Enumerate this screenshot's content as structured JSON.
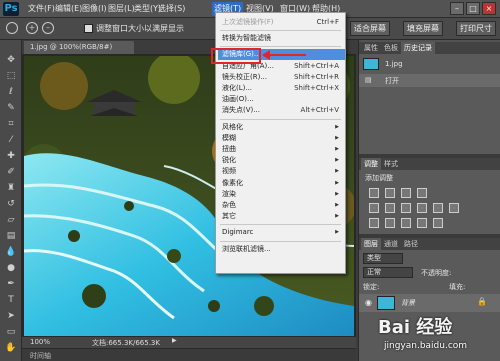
{
  "app": {
    "logo": "Ps"
  },
  "menubar": {
    "items": [
      "文件(F)",
      "编辑(E)",
      "图像(I)",
      "图层(L)",
      "类型(Y)",
      "选择(S)",
      "滤镜(T)",
      "视图(V)",
      "窗口(W)",
      "帮助(H)"
    ],
    "active_index": 6
  },
  "options": {
    "checkbox_label": "调整窗口大小以满屏显示",
    "buttons": [
      "适合屏幕",
      "填充屏幕",
      "打印尺寸"
    ]
  },
  "document": {
    "tab_title": "1.jpg @ 100%(RGB/8#)",
    "zoom": "100%",
    "doc_info": "文档:665.3K/665.3K",
    "timeline_label": "时间轴"
  },
  "filter_menu": {
    "items": [
      {
        "label": "上次滤镜操作(F)",
        "shortcut": "Ctrl+F",
        "disabled": true
      },
      {
        "sep": true
      },
      {
        "label": "转换为智能滤镜"
      },
      {
        "sep": true
      },
      {
        "label": "滤镜库(G)...",
        "highlighted": true
      },
      {
        "label": "自适应广角(A)...",
        "shortcut": "Shift+Ctrl+A"
      },
      {
        "label": "镜头校正(R)...",
        "shortcut": "Shift+Ctrl+R"
      },
      {
        "label": "液化(L)...",
        "shortcut": "Shift+Ctrl+X"
      },
      {
        "label": "油画(O)..."
      },
      {
        "label": "消失点(V)...",
        "shortcut": "Alt+Ctrl+V"
      },
      {
        "sep": true
      },
      {
        "label": "风格化",
        "sub": true
      },
      {
        "label": "模糊",
        "sub": true
      },
      {
        "label": "扭曲",
        "sub": true
      },
      {
        "label": "锐化",
        "sub": true
      },
      {
        "label": "视频",
        "sub": true
      },
      {
        "label": "像素化",
        "sub": true
      },
      {
        "label": "渲染",
        "sub": true
      },
      {
        "label": "杂色",
        "sub": true
      },
      {
        "label": "其它",
        "sub": true
      },
      {
        "sep": true
      },
      {
        "label": "Digimarc",
        "sub": true
      },
      {
        "sep": true
      },
      {
        "label": "浏览联机滤镜..."
      }
    ]
  },
  "history_panel": {
    "tabs": [
      "属性",
      "色板",
      "历史记录"
    ],
    "active_tab": 2,
    "snapshot": "1.jpg",
    "steps": [
      "打开"
    ]
  },
  "adjust_panel": {
    "tabs": [
      "调整",
      "样式"
    ],
    "title": "添加调整"
  },
  "layers_panel": {
    "tabs": [
      "图层",
      "通道",
      "路径"
    ],
    "kind_label": "类型",
    "blend_mode": "正常",
    "opacity_label": "不透明度:",
    "lock_label": "锁定:",
    "fill_label": "填充:",
    "layer_name": "背景"
  },
  "watermark": {
    "main": "Bai 经验",
    "sub": "jingyan.baidu.com"
  },
  "colors": {
    "accent": "#2b6cc4",
    "highlight": "#4f8ede",
    "annotation": "#e0262b",
    "water": "#3fc1e0"
  }
}
